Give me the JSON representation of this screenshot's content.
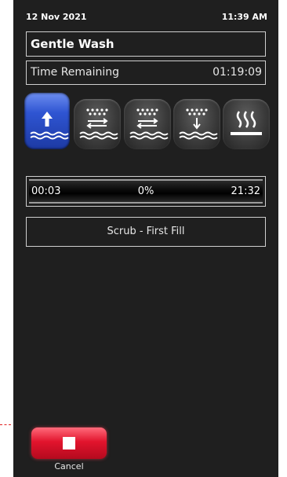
{
  "status": {
    "date": "12 Nov 2021",
    "time": "11:39 AM"
  },
  "program": {
    "name": "Gentle Wash"
  },
  "remaining": {
    "label": "Time Remaining",
    "value": "01:19:09"
  },
  "steps": [
    {
      "icon": "fill-up-arrow-icon",
      "active": true
    },
    {
      "icon": "scrub-wash-icon",
      "active": false
    },
    {
      "icon": "scrub-wash-icon",
      "active": false
    },
    {
      "icon": "rinse-drain-icon",
      "active": false
    },
    {
      "icon": "dry-heat-icon",
      "active": false
    }
  ],
  "progress": {
    "elapsed": "00:03",
    "percent_label": "0%",
    "total": "21:32",
    "fraction": 0.0
  },
  "phase": {
    "label": "Scrub - First Fill"
  },
  "cancel": {
    "label": "Cancel"
  },
  "colors": {
    "background": "#1f1f1f",
    "active_step": "#2f55d2",
    "cancel": "#e2142d"
  }
}
